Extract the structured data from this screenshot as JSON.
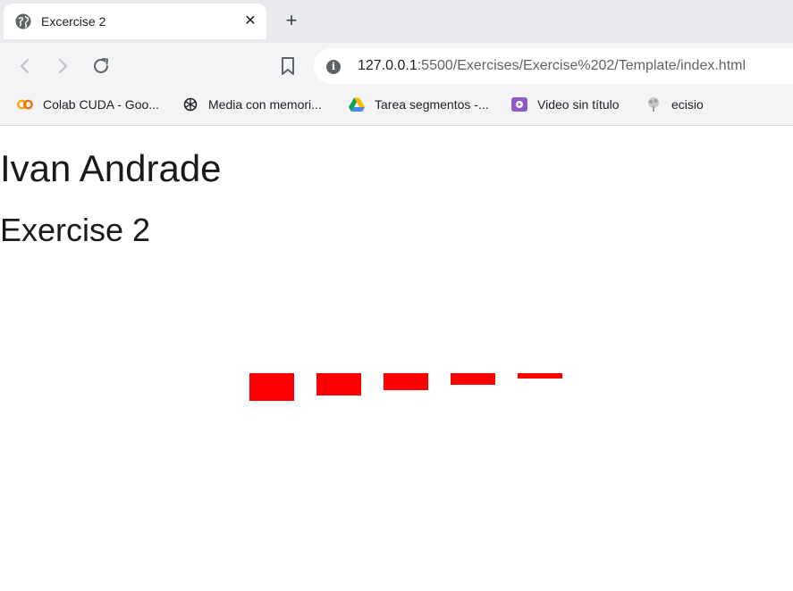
{
  "browser": {
    "tab": {
      "title": "Excercise 2",
      "close_label": "✕",
      "favicon": "globe-icon"
    },
    "new_tab_label": "+",
    "address": {
      "host": "127.0.0.1",
      "rest": ":5500/Exercises/Exercise%202/Template/index.html",
      "icon": "info-icon"
    },
    "bookmarks": [
      {
        "label": "Colab CUDA - Goo...",
        "icon": "colab-icon"
      },
      {
        "label": "Media con memori...",
        "icon": "openai-icon"
      },
      {
        "label": "Tarea segmentos -...",
        "icon": "google-drive-icon"
      },
      {
        "label": "Video sin título",
        "icon": "video-icon"
      },
      {
        "label": "ecisio",
        "icon": "tree-icon"
      }
    ]
  },
  "page": {
    "name": "Ivan Andrade",
    "exercise": "Exercise 2",
    "bars": {
      "color": "#ff0000",
      "heights": [
        31,
        25,
        19,
        13,
        6
      ]
    }
  }
}
